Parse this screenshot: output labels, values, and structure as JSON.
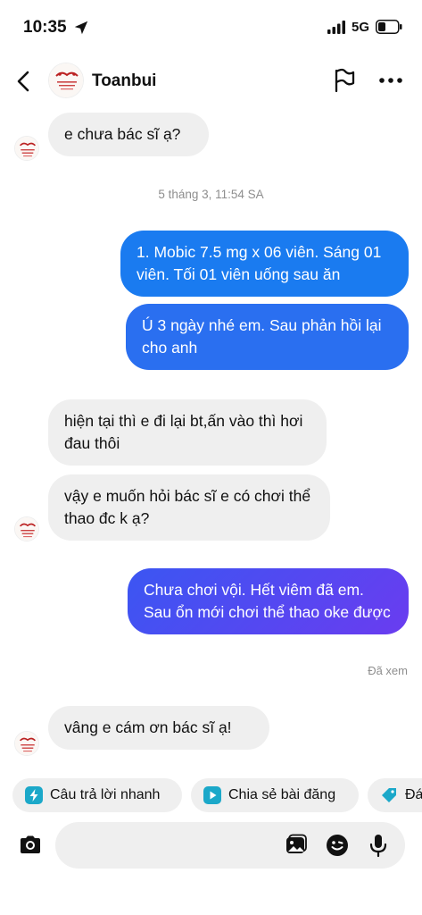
{
  "status_bar": {
    "time": "10:35",
    "network": "5G",
    "icons": [
      "location-arrow-icon",
      "signal-icon",
      "battery-icon"
    ]
  },
  "header": {
    "contact_name": "Toanbui",
    "icons": [
      "chevron-left-icon",
      "flag-icon",
      "more-horizontal-icon"
    ]
  },
  "messages": [
    {
      "direction": "in",
      "text": "e chưa bác sĩ ạ?"
    },
    {
      "direction": "out",
      "text": "1. Mobic 7.5 mg x 06 viên. Sáng 01 viên. Tối 01 viên uống sau ăn"
    },
    {
      "direction": "out",
      "text": "Ú 3 ngày nhé em. Sau phản hồi lại cho anh"
    },
    {
      "direction": "in",
      "text": "hiện tại thì e đi lại bt,ấn vào thì hơi đau thôi"
    },
    {
      "direction": "in",
      "text": "vậy e muốn hỏi bác sĩ e có chơi thể thao đc k ạ?"
    },
    {
      "direction": "out",
      "text": "Chưa chơi vội. Hết viêm đã em. Sau ổn mới chơi thể thao oke được"
    },
    {
      "direction": "in",
      "text": "vâng e cám ơn bác sĩ ạ!"
    }
  ],
  "timestamp": "5 tháng 3, 11:54 SA",
  "seen_label": "Đã xem",
  "quick_actions": [
    {
      "label": "Câu trả lời nhanh",
      "icon": "lightning-icon"
    },
    {
      "label": "Chia sẻ bài đăng",
      "icon": "play-square-icon"
    },
    {
      "label": "Đá",
      "icon": "tag-icon"
    }
  ],
  "composer": {
    "placeholder": "",
    "icons": [
      "camera-icon",
      "gallery-icon",
      "sticker-icon",
      "microphone-icon"
    ]
  },
  "colors": {
    "incoming_bubble": "#efefef",
    "outgoing_top": "#1a7bf0",
    "outgoing_bottom": "#5a3ff0",
    "secondary_text": "#8e8e8e",
    "quick_action_icon": "#1ba8c9"
  }
}
